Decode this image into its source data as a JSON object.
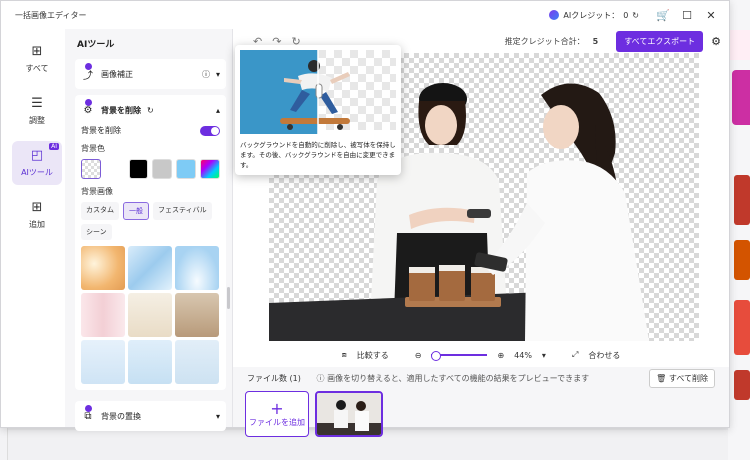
{
  "window": {
    "title": "一括画像エディター"
  },
  "titlebar": {
    "credit_label": "AIクレジット：",
    "credit_value": "0"
  },
  "rail": {
    "items": [
      {
        "label": "すべて"
      },
      {
        "label": "調整"
      },
      {
        "label": "AIツール",
        "badge": "AI"
      },
      {
        "label": "追加"
      }
    ]
  },
  "panel": {
    "title": "AIツール",
    "enhance": {
      "label": "画像補正"
    },
    "remove_bg": {
      "label": "背景を削除",
      "toggle_label": "背景を削除",
      "color_label": "背景色",
      "image_label": "背景画像",
      "categories": [
        "カスタム",
        "一般",
        "フェスティバル",
        "シーン"
      ],
      "active_category": "一般"
    },
    "replace_bg": {
      "label": "背景の置換"
    }
  },
  "canvas": {
    "estimated_label": "推定クレジット合計：",
    "estimated_value": "5",
    "export_label": "すべてエクスポート",
    "compare_label": "比較する",
    "zoom": "44%",
    "fit_label": "合わせる",
    "files_label": "ファイル数 (1)",
    "hint": "画像を切り替えると、適用したすべての機能の結果をプレビューできます",
    "delete_all_label": "すべて削除",
    "add_file_label": "ファイルを追加"
  },
  "popup": {
    "description": "バックグラウンドを自動的に削除し、被写体を保持します。その後、バックグラウンドを自由に変更できます。"
  },
  "colors": {
    "accent": "#6d2ee0",
    "accent_light": "#ebe6f7"
  }
}
